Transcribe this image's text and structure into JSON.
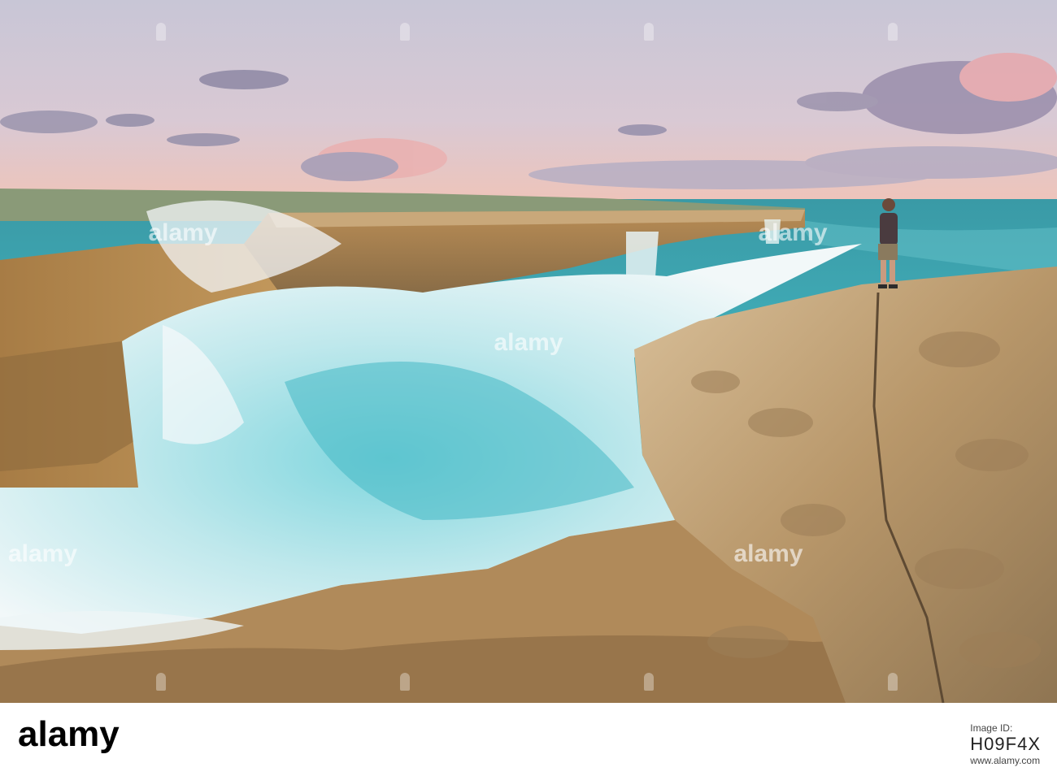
{
  "photo": {
    "subject": "waves crashing on limestone coast with person standing on rock at sunset",
    "watermark": "alamy"
  },
  "footer": {
    "brand": "alamy",
    "image_id_label": "Image ID:",
    "image_id": "H09F4X",
    "url": "www.alamy.com"
  },
  "colors": {
    "sky_top": "#c9c7d8",
    "sky_bottom": "#f2c7b8",
    "sea": "#3fb3c0",
    "rock": "#c9a678",
    "foam": "#eef6f7"
  }
}
